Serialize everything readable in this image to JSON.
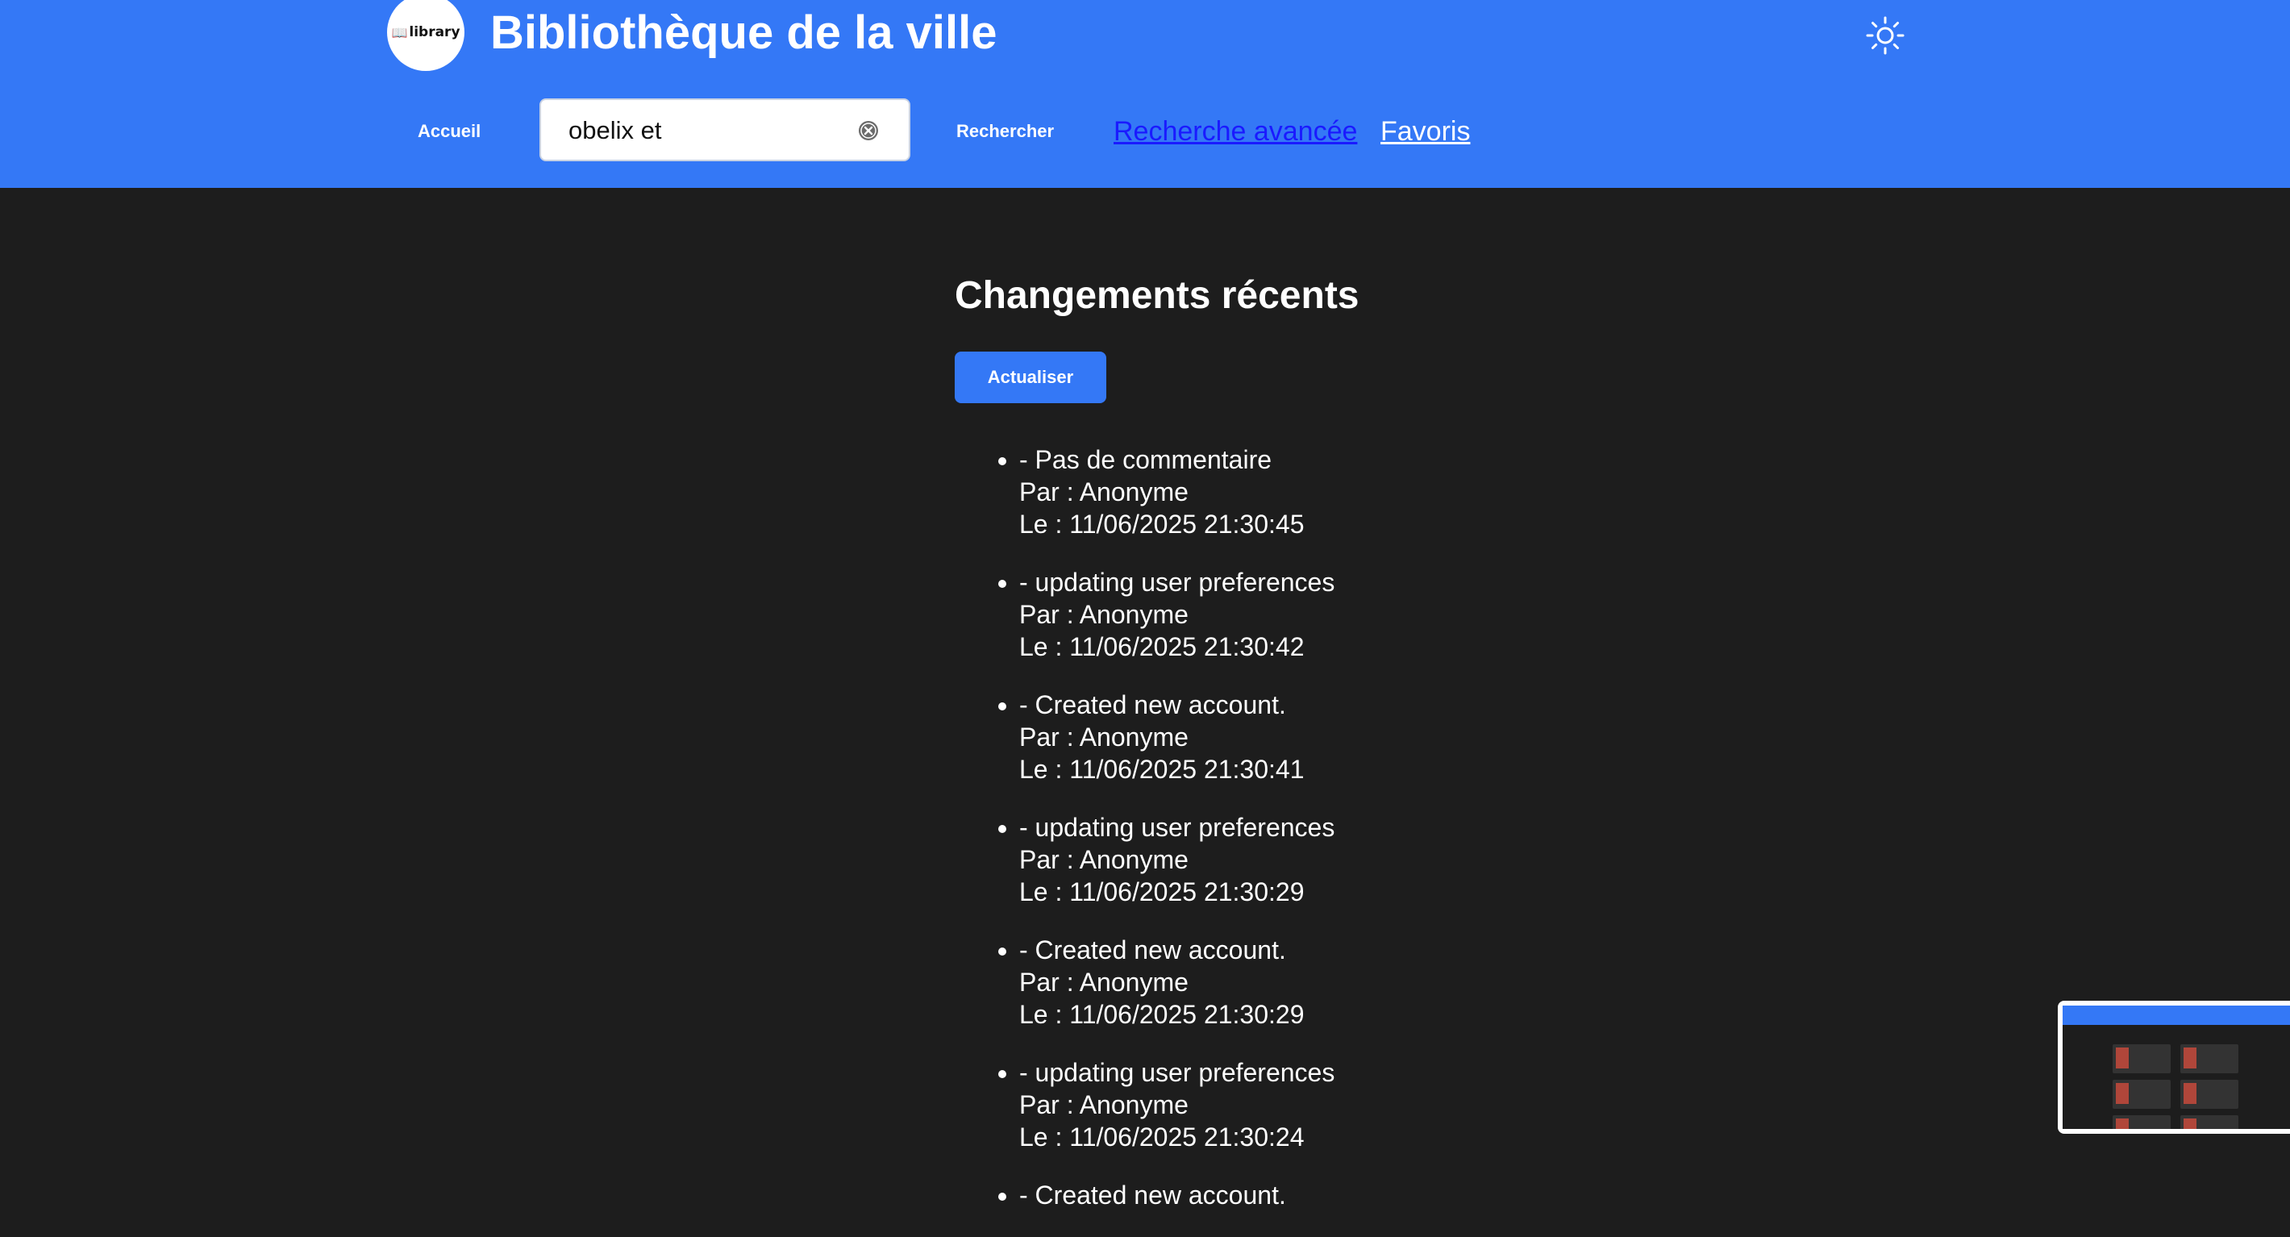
{
  "header": {
    "logo_text": "library",
    "title": "Bibliothèque de la ville",
    "theme_icon": "sun-icon",
    "nav_home": "Accueil",
    "search": {
      "value": "obelix et",
      "placeholder": ""
    },
    "search_button": "Rechercher",
    "advanced_search_link": "Recherche avancée",
    "favorites_link": "Favoris"
  },
  "main": {
    "heading": "Changements récents",
    "refresh_button": "Actualiser",
    "changes": [
      {
        "comment": "- Pas de commentaire",
        "by": "Par : Anonyme",
        "date": "Le : 11/06/2025 21:30:45"
      },
      {
        "comment": "- updating user preferences",
        "by": "Par : Anonyme",
        "date": "Le : 11/06/2025 21:30:42"
      },
      {
        "comment": "- Created new account.",
        "by": "Par : Anonyme",
        "date": "Le : 11/06/2025 21:30:41"
      },
      {
        "comment": "- updating user preferences",
        "by": "Par : Anonyme",
        "date": "Le : 11/06/2025 21:30:29"
      },
      {
        "comment": "- Created new account.",
        "by": "Par : Anonyme",
        "date": "Le : 11/06/2025 21:30:29"
      },
      {
        "comment": "- updating user preferences",
        "by": "Par : Anonyme",
        "date": "Le : 11/06/2025 21:30:24"
      },
      {
        "comment": "- Created new account.",
        "by": "",
        "date": ""
      }
    ]
  },
  "colors": {
    "brand_blue": "#3478f6",
    "background": "#1d1d1d",
    "link_blue": "#1a1aff"
  }
}
